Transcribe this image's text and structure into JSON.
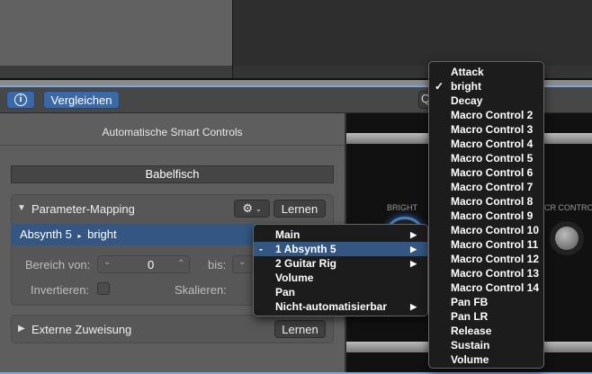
{
  "toolbar": {
    "info_icon": "info-icon",
    "compare_label": "Vergleichen",
    "q_label": "Q"
  },
  "panel": {
    "title": "Automatische Smart Controls",
    "control_name": "Babelfisch",
    "mapping": {
      "header": "Parameter-Mapping",
      "learn_label": "Lernen",
      "gear_icon": "gear-icon",
      "selected": "Absynth 5",
      "selected_param": "bright",
      "range_from_label": "Bereich von:",
      "range_from_value": "0",
      "range_to_label": "bis:",
      "invert_label": "Invertieren:",
      "invert_checked": false,
      "scale_label": "Skalieren:"
    },
    "external": {
      "header": "Externe Zuweisung",
      "learn_label": "Lernen"
    }
  },
  "plugin": {
    "knob1_label": "BRIGHT",
    "knob2_label": "CR CONTROL"
  },
  "menu1": {
    "items": [
      {
        "label": "Main",
        "submenu": true,
        "mark": ""
      },
      {
        "label": "1 Absynth 5",
        "submenu": true,
        "mark": "-",
        "highlighted": true
      },
      {
        "label": "2 Guitar Rig",
        "submenu": true,
        "mark": ""
      },
      {
        "label": "Volume",
        "submenu": false,
        "mark": ""
      },
      {
        "label": "Pan",
        "submenu": false,
        "mark": ""
      },
      {
        "label": "Nicht-automatisierbar",
        "submenu": true,
        "mark": ""
      }
    ]
  },
  "menu2": {
    "items": [
      {
        "label": "Attack",
        "mark": ""
      },
      {
        "label": "bright",
        "mark": "✓"
      },
      {
        "label": "Decay",
        "mark": ""
      },
      {
        "label": "Macro Control 2",
        "mark": ""
      },
      {
        "label": "Macro Control 3",
        "mark": ""
      },
      {
        "label": "Macro Control 4",
        "mark": ""
      },
      {
        "label": "Macro Control 5",
        "mark": ""
      },
      {
        "label": "Macro Control 6",
        "mark": ""
      },
      {
        "label": "Macro Control 7",
        "mark": ""
      },
      {
        "label": "Macro Control 8",
        "mark": ""
      },
      {
        "label": "Macro Control 9",
        "mark": ""
      },
      {
        "label": "Macro Control 10",
        "mark": ""
      },
      {
        "label": "Macro Control 11",
        "mark": ""
      },
      {
        "label": "Macro Control 12",
        "mark": ""
      },
      {
        "label": "Macro Control 13",
        "mark": ""
      },
      {
        "label": "Macro Control 14",
        "mark": ""
      },
      {
        "label": "Pan FB",
        "mark": ""
      },
      {
        "label": "Pan LR",
        "mark": ""
      },
      {
        "label": "Release",
        "mark": ""
      },
      {
        "label": "Sustain",
        "mark": ""
      },
      {
        "label": "Volume",
        "mark": ""
      }
    ]
  }
}
